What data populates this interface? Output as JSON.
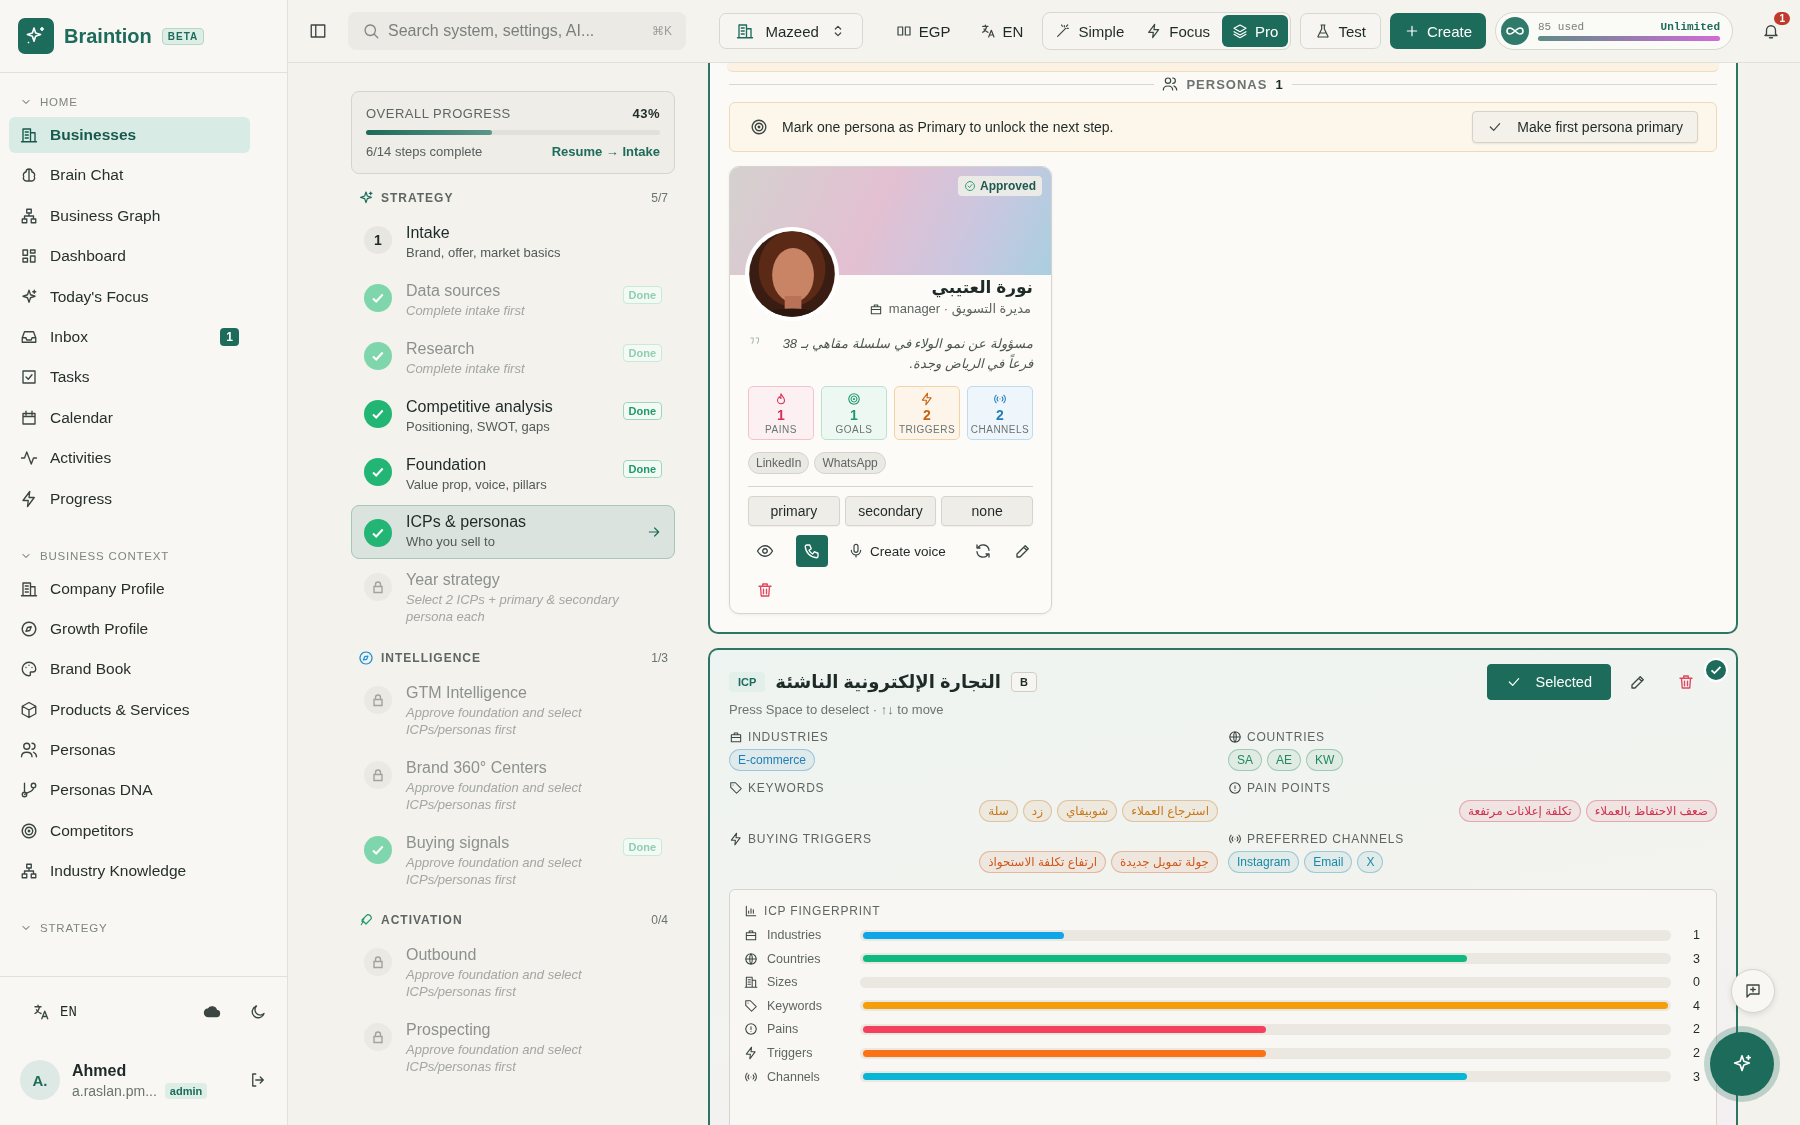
{
  "app": {
    "name": "Braintion",
    "badge": "BETA"
  },
  "sidebar": {
    "sections": [
      {
        "title": "HOME",
        "expanded": true,
        "items": [
          {
            "label": "Businesses",
            "selected": true
          },
          {
            "label": "Brain Chat",
            "selected": false
          },
          {
            "label": "Business Graph",
            "selected": false
          },
          {
            "label": "Dashboard",
            "selected": false
          },
          {
            "label": "Today's Focus",
            "selected": false
          },
          {
            "label": "Inbox",
            "selected": false,
            "count": "1"
          },
          {
            "label": "Tasks",
            "selected": false
          },
          {
            "label": "Calendar",
            "selected": false
          },
          {
            "label": "Activities",
            "selected": false
          },
          {
            "label": "Progress",
            "selected": false
          }
        ]
      },
      {
        "title": "BUSINESS CONTEXT",
        "expanded": true,
        "items": [
          {
            "label": "Company Profile",
            "selected": false
          },
          {
            "label": "Growth Profile",
            "selected": false
          },
          {
            "label": "Brand Book",
            "selected": false
          },
          {
            "label": "Products & Services",
            "selected": false
          },
          {
            "label": "Personas",
            "selected": false
          },
          {
            "label": "Personas DNA",
            "selected": false
          },
          {
            "label": "Competitors",
            "selected": false
          },
          {
            "label": "Industry Knowledge",
            "selected": false
          }
        ]
      },
      {
        "title": "STRATEGY",
        "expanded": true
      }
    ],
    "language": "EN",
    "user": {
      "initials": "A.",
      "name": "Ahmed",
      "email": "a.raslan.pm...",
      "role": "admin"
    }
  },
  "topbar": {
    "search": {
      "placeholder": "Search system, settings, AI...",
      "shortcut": "⌘K"
    },
    "workspace": "Mazeed",
    "currency": "EGP",
    "language": "EN",
    "modes": [
      {
        "label": "Simple",
        "selected": false
      },
      {
        "label": "Focus",
        "selected": false
      },
      {
        "label": "Pro",
        "selected": true
      }
    ],
    "test": "Test",
    "create": "Create",
    "usage": {
      "used": "85 used",
      "limit": "Unlimited",
      "level": 1
    },
    "notifications": "1"
  },
  "progress": {
    "title": "OVERALL PROGRESS",
    "percent": "43%",
    "level": 0.43,
    "caption": "6/14 steps complete",
    "link": "Resume → Intake",
    "groups": [
      {
        "title": "STRATEGY",
        "count": "5/7",
        "steps": [
          {
            "title": "Intake",
            "subtitle": "Brand, offer, market basics",
            "kind": "todo",
            "number": "1",
            "muted": false,
            "selected": false
          },
          {
            "title": "Data sources",
            "subtitle": "Complete intake first",
            "kind": "done",
            "muted": true,
            "badge": "Done",
            "selected": false
          },
          {
            "title": "Research",
            "subtitle": "Complete intake first",
            "kind": "done",
            "muted": true,
            "badge": "Done",
            "selected": false
          },
          {
            "title": "Competitive analysis",
            "subtitle": "Positioning, SWOT, gaps",
            "kind": "done",
            "muted": false,
            "badge": "Done",
            "selected": false
          },
          {
            "title": "Foundation",
            "subtitle": "Value prop, voice, pillars",
            "kind": "done",
            "muted": false,
            "badge": "Done",
            "selected": false
          },
          {
            "title": "ICPs & personas",
            "subtitle": "Who you sell to",
            "kind": "done",
            "muted": false,
            "selected": true
          },
          {
            "title": "Year strategy",
            "subtitle": "Select 2 ICPs + primary & secondary persona each",
            "kind": "locked",
            "muted": true,
            "selected": false
          }
        ]
      },
      {
        "title": "INTELLIGENCE",
        "count": "1/3",
        "steps": [
          {
            "title": "GTM Intelligence",
            "subtitle": "Approve foundation and select ICPs/personas first",
            "kind": "locked",
            "muted": true,
            "selected": false
          },
          {
            "title": "Brand 360° Centers",
            "subtitle": "Approve foundation and select ICPs/personas first",
            "kind": "locked",
            "muted": true,
            "selected": false
          },
          {
            "title": "Buying signals",
            "subtitle": "Approve foundation and select ICPs/personas first",
            "kind": "done",
            "muted": true,
            "badge": "Done",
            "selected": false
          }
        ]
      },
      {
        "title": "ACTIVATION",
        "count": "0/4",
        "steps": [
          {
            "title": "Outbound",
            "subtitle": "Approve foundation and select ICPs/personas first",
            "kind": "locked",
            "muted": true,
            "selected": false
          },
          {
            "title": "Prospecting",
            "subtitle": "Approve foundation and select ICPs/personas first",
            "kind": "locked",
            "muted": true,
            "selected": false
          }
        ]
      }
    ]
  },
  "personas": {
    "title": "PERSONAS",
    "count": "1",
    "notice": "Mark one persona as Primary to unlock the next step.",
    "notice_button": "Make first persona primary",
    "items": [
      {
        "status": "Approved",
        "name": "نورة العتيبي",
        "role": "مديرة التسويق · manager",
        "quote": "مسؤولة عن نمو الولاء في سلسلة مقاهي بـ 38 فرعاً في الرياض وجدة.",
        "stats": [
          {
            "kind": "pains",
            "value": "1",
            "label": "PAINS"
          },
          {
            "kind": "goals",
            "value": "1",
            "label": "GOALS"
          },
          {
            "kind": "triggers",
            "value": "2",
            "label": "TRIGGERS"
          },
          {
            "kind": "channels",
            "value": "2",
            "label": "CHANNELS"
          }
        ],
        "channels": [
          "LinkedIn",
          "WhatsApp"
        ],
        "priorities": [
          {
            "label": "primary",
            "selected": false
          },
          {
            "label": "secondary",
            "selected": false
          },
          {
            "label": "none",
            "selected": false
          }
        ],
        "voice_button": "Create voice"
      }
    ]
  },
  "icp": {
    "tag": "ICP",
    "title": "التجارة الإلكترونية الناشئة",
    "grade": "B",
    "hint": "Press Space to deselect · ↑↓ to move",
    "selected": true,
    "selected_label": "Selected",
    "fields": [
      {
        "label": "INDUSTRIES",
        "color": "#1f7fb8",
        "tags": [
          "E-commerce"
        ]
      },
      {
        "label": "COUNTRIES",
        "color": "#1f8a5b",
        "tags": [
          "SA",
          "AE",
          "KW"
        ]
      },
      {
        "label": "KEYWORDS",
        "color": "#c7791a",
        "tags": [
          "استرجاع العملاء",
          "شوبيفاي",
          "زد",
          "سلة"
        ]
      },
      {
        "label": "PAIN POINTS",
        "color": "#d0304f",
        "tags": [
          "ضعف الاحتفاظ بالعملاء",
          "تكلفة إعلانات مرتفعة"
        ]
      },
      {
        "label": "BUYING TRIGGERS",
        "color": "#d0581a",
        "tags": [
          "جولة تمويل جديدة",
          "ارتفاع تكلفة الاستحواذ"
        ]
      },
      {
        "label": "PREFERRED CHANNELS",
        "color": "#1a88a8",
        "tags": [
          "Instagram",
          "Email",
          "X"
        ]
      }
    ],
    "fingerprint": {
      "title": "ICP FINGERPRINT",
      "rows": [
        {
          "label": "Industries",
          "value": "1",
          "level": 0.25,
          "color": "#0ea5e9"
        },
        {
          "label": "Countries",
          "value": "3",
          "level": 0.75,
          "color": "#10b981"
        },
        {
          "label": "Sizes",
          "value": "0"
        },
        {
          "label": "Keywords",
          "value": "4",
          "level": 1,
          "color": "#f59e0b"
        },
        {
          "label": "Pains",
          "value": "2",
          "level": 0.5,
          "color": "#f43f5e"
        },
        {
          "label": "Triggers",
          "value": "2",
          "level": 0.5,
          "color": "#f97316"
        },
        {
          "label": "Channels",
          "value": "3",
          "level": 0.75,
          "color": "#06b6d4"
        }
      ]
    }
  }
}
